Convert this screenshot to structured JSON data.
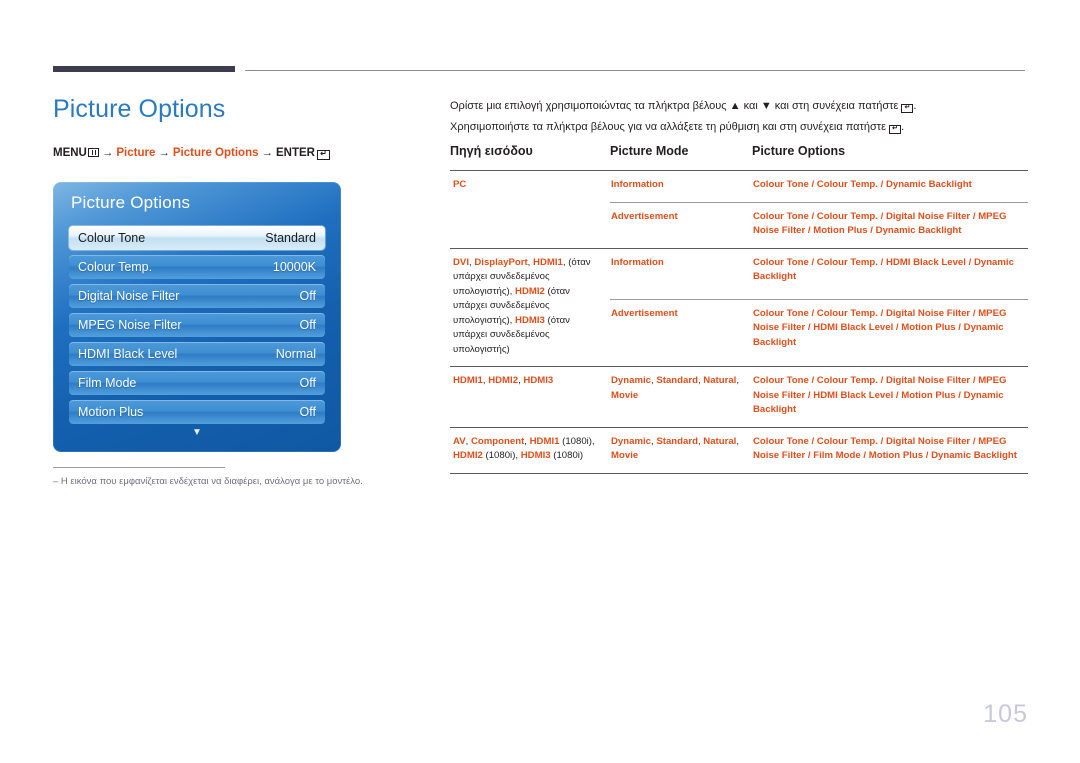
{
  "header": {
    "page_title": "Picture Options",
    "breadcrumb": {
      "menu_label": "MENU",
      "menu_icon": "menu-grid-icon",
      "arrow": "→",
      "item1": "Picture",
      "item2": "Picture Options",
      "enter_label": "ENTER",
      "enter_icon": "enter-key-icon"
    }
  },
  "osd": {
    "title": "Picture Options",
    "rows": [
      {
        "label": "Colour Tone",
        "value": "Standard",
        "selected": true
      },
      {
        "label": "Colour Temp.",
        "value": "10000K",
        "selected": false
      },
      {
        "label": "Digital Noise Filter",
        "value": "Off",
        "selected": false
      },
      {
        "label": "MPEG Noise Filter",
        "value": "Off",
        "selected": false
      },
      {
        "label": "HDMI Black Level",
        "value": "Normal",
        "selected": false
      },
      {
        "label": "Film Mode",
        "value": "Off",
        "selected": false
      },
      {
        "label": "Motion Plus",
        "value": "Off",
        "selected": false
      }
    ],
    "more_icon": "chevron-down-icon",
    "more_glyph": "▼"
  },
  "footnote": "–  Η εικόνα που εμφανίζεται ενδέχεται να διαφέρει, ανάλογα με το μοντέλο.",
  "intro": {
    "line1_before": "Ορίστε μια επιλογή χρησιμοποιώντας τα πλήκτρα βέλους ▲ και ▼ και στη συνέχεια πατήστε ",
    "line1_after": ".",
    "line2_before": "Χρησιμοποιήστε τα πλήκτρα βέλους για να αλλάξετε τη ρύθμιση και στη συνέχεια πατήστε ",
    "line2_after": "."
  },
  "table": {
    "headers": {
      "source": "Πηγή εισόδου",
      "picture_mode": "Picture Mode",
      "picture_options": "Picture Options"
    },
    "groups": [
      {
        "source_html": "<span class=\"or\">PC</span>",
        "rows": [
          {
            "mode_html": "<span class=\"or\">Information</span>",
            "options_html": "<span class=\"or\">Colour Tone</span> <span class=\"sep\">/</span> <span class=\"or\">Colour Temp.</span> <span class=\"sep\">/</span> <span class=\"or\">Dynamic Backlight</span>"
          },
          {
            "mode_html": "<span class=\"or\">Advertisement</span>",
            "options_html": "<span class=\"or\">Colour Tone</span> <span class=\"sep\">/</span> <span class=\"or\">Colour Temp.</span> <span class=\"sep\">/</span> <span class=\"or\">Digital Noise Filter</span> <span class=\"sep\">/</span> <span class=\"or\">MPEG Noise Filter</span> <span class=\"sep\">/</span> <span class=\"or\">Motion Plus</span> <span class=\"sep\">/</span> <span class=\"or\">Dynamic Backlight</span>"
          }
        ]
      },
      {
        "source_html": "<span class=\"or\">DVI</span><span class=\"nm\">,</span> <span class=\"or\">DisplayPort</span><span class=\"nm\">,</span> <span class=\"or\">HDMI1</span><span class=\"nm\">, (όταν υπάρχει συνδεδεμένος υπολογιστής),</span> <span class=\"or\">HDMI2</span><span class=\"nm\"> (όταν υπάρχει συνδεδεμένος υπολογιστής),</span> <span class=\"or\">HDMI3</span><span class=\"nm\"> (όταν υπάρχει συνδεδεμένος υπολογιστής)</span>",
        "rows": [
          {
            "mode_html": "<span class=\"or\">Information</span>",
            "options_html": "<span class=\"or\">Colour Tone</span> <span class=\"sep\">/</span> <span class=\"or\">Colour Temp.</span> <span class=\"sep\">/</span> <span class=\"or\">HDMI Black Level</span> <span class=\"sep\">/</span> <span class=\"or\">Dynamic Backlight</span>"
          },
          {
            "mode_html": "<span class=\"or\">Advertisement</span>",
            "options_html": "<span class=\"or\">Colour Tone</span> <span class=\"sep\">/</span> <span class=\"or\">Colour Temp.</span> <span class=\"sep\">/</span> <span class=\"or\">Digital Noise Filter</span> <span class=\"sep\">/</span> <span class=\"or\">MPEG Noise Filter</span> <span class=\"sep\">/</span> <span class=\"or\">HDMI Black Level</span> <span class=\"sep\">/</span> <span class=\"or\">Motion Plus</span> <span class=\"sep\">/</span> <span class=\"or\">Dynamic Backlight</span>"
          }
        ]
      },
      {
        "source_html": "<span class=\"or\">HDMI1</span><span class=\"nm\">,</span> <span class=\"or\">HDMI2</span><span class=\"nm\">,</span> <span class=\"or\">HDMI3</span>",
        "rows": [
          {
            "mode_html": "<span class=\"or\">Dynamic</span><span class=\"nm\">,</span> <span class=\"or\">Standard</span><span class=\"nm\">,</span> <span class=\"or\">Natural</span><span class=\"nm\">,</span> <span class=\"or\">Movie</span>",
            "options_html": "<span class=\"or\">Colour Tone</span> <span class=\"sep\">/</span> <span class=\"or\">Colour Temp.</span> <span class=\"sep\">/</span> <span class=\"or\">Digital Noise Filter</span> <span class=\"sep\">/</span> <span class=\"or\">MPEG Noise Filter</span> <span class=\"sep\">/</span> <span class=\"or\">HDMI Black Level</span> <span class=\"sep\">/</span> <span class=\"or\">Motion Plus</span> <span class=\"sep\">/</span> <span class=\"or\">Dynamic Backlight</span>"
          }
        ]
      },
      {
        "source_html": "<span class=\"or\">AV</span><span class=\"nm\">,</span> <span class=\"or\">Component</span><span class=\"nm\">,</span> <span class=\"or\">HDMI1</span><span class=\"nm\"> (1080i),</span> <span class=\"or\">HDMI2</span><span class=\"nm\"> (1080i),</span> <span class=\"or\">HDMI3</span><span class=\"nm\"> (1080i)</span>",
        "rows": [
          {
            "mode_html": "<span class=\"or\">Dynamic</span><span class=\"nm\">,</span> <span class=\"or\">Standard</span><span class=\"nm\">,</span> <span class=\"or\">Natural</span><span class=\"nm\">,</span> <span class=\"or\">Movie</span>",
            "options_html": "<span class=\"or\">Colour Tone</span> <span class=\"sep\">/</span> <span class=\"or\">Colour Temp.</span> <span class=\"sep\">/</span> <span class=\"or\">Digital Noise Filter</span> <span class=\"sep\">/</span> <span class=\"or\">MPEG Noise Filter</span> <span class=\"sep\">/</span> <span class=\"or\">Film Mode</span> <span class=\"sep\">/</span> <span class=\"or\">Motion Plus</span> <span class=\"sep\">/</span> <span class=\"or\">Dynamic Backlight</span>"
          }
        ]
      }
    ]
  },
  "page_number": "105",
  "colors": {
    "accent_orange": "#e04e1b",
    "title_blue": "#2a7ac0",
    "rule_dark": "#3e3d4f",
    "page_number_gray": "#c8c8da",
    "osd_blue": "#1460ae"
  }
}
